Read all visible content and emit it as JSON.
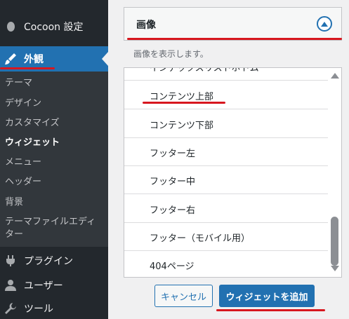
{
  "sidebar": {
    "top_item": {
      "label": "Cocoon 設定",
      "icon": "cocoon-icon"
    },
    "active_item": {
      "label": "外観",
      "icon": "paintbrush-icon"
    },
    "submenu": [
      {
        "label": "テーマ"
      },
      {
        "label": "デザイン"
      },
      {
        "label": "カスタマイズ"
      },
      {
        "label": "ウィジェット",
        "current": true
      },
      {
        "label": "メニュー"
      },
      {
        "label": "ヘッダー"
      },
      {
        "label": "背景"
      },
      {
        "label": "テーマファイルエディター"
      }
    ],
    "bottom_items": [
      {
        "label": "プラグイン",
        "icon": "plugin-icon"
      },
      {
        "label": "ユーザー",
        "icon": "user-icon"
      },
      {
        "label": "ツール",
        "icon": "wrench-icon"
      }
    ]
  },
  "panel": {
    "title": "画像",
    "description": "画像を表示します。",
    "areas": [
      "インデックスリストボトム",
      "コンテンツ上部",
      "コンテンツ下部",
      "フッター左",
      "フッター中",
      "フッター右",
      "フッター（モバイル用）",
      "404ページ"
    ],
    "buttons": {
      "cancel": "キャンセル",
      "add": "ウィジェットを追加"
    }
  },
  "colors": {
    "accent": "#2271b1",
    "annotation": "#d7171f",
    "sidebar_bg": "#23282d"
  }
}
